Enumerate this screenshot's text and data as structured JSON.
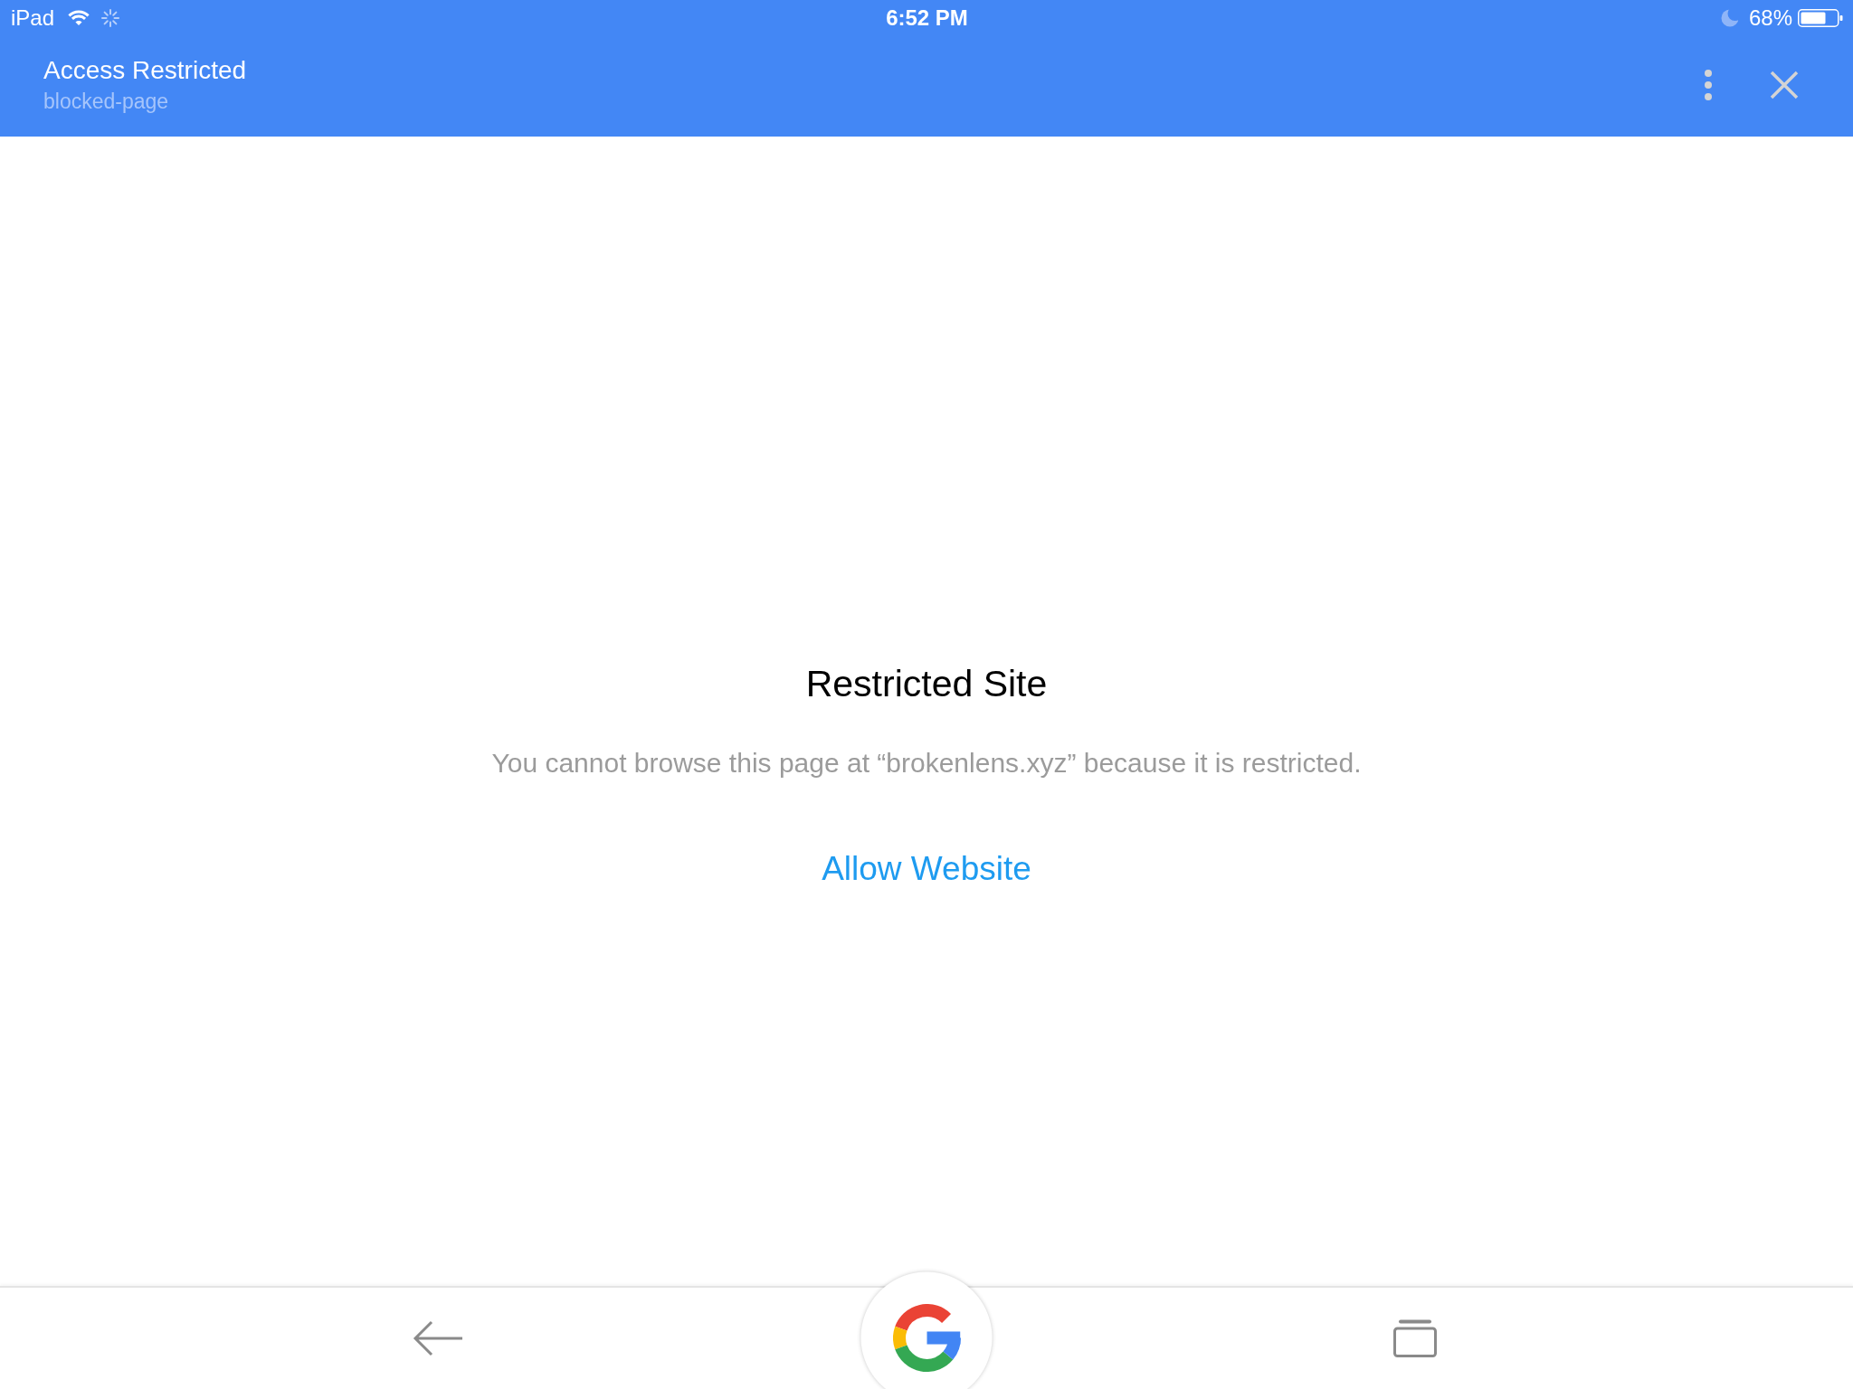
{
  "status_bar": {
    "device": "iPad",
    "time": "6:52 PM",
    "battery": "68%"
  },
  "header": {
    "title": "Access Restricted",
    "subtitle": "blocked-page"
  },
  "content": {
    "heading": "Restricted Site",
    "message": "You cannot browse this page at “brokenlens.xyz” because it is restricted.",
    "action": "Allow Website"
  }
}
